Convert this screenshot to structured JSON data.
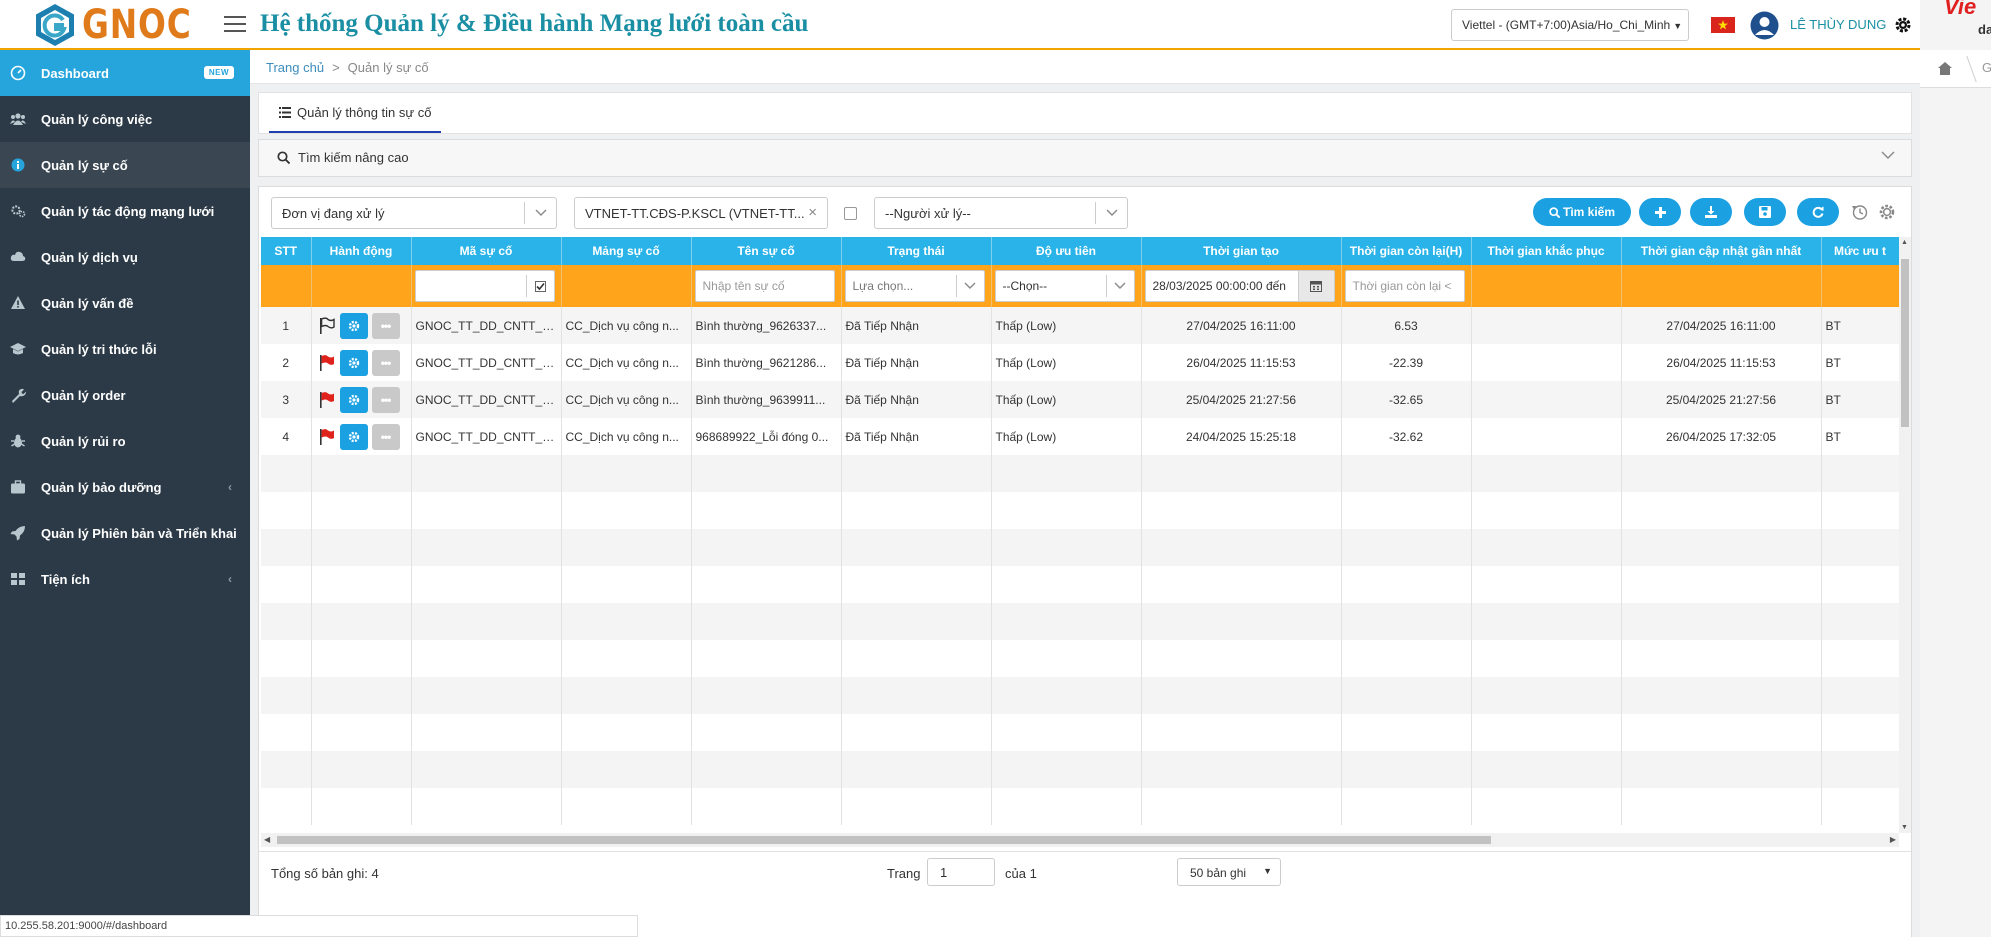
{
  "header": {
    "logo_text": "GNOC",
    "title": "Hệ thống Quản lý & Điều hành Mạng lưới toàn cầu",
    "timezone": "Viettel - (GMT+7:00)Asia/Ho_Chi_Minh",
    "user_name": "LÊ THÙY DUNG"
  },
  "right_strip": {
    "brand": "Vie",
    "brand_sub": "da",
    "crumb": "G"
  },
  "sidebar": {
    "items": [
      {
        "label": "Dashboard",
        "badge": "NEW",
        "icon": "dashboard-icon"
      },
      {
        "label": "Quản lý công việc",
        "icon": "users-icon"
      },
      {
        "label": "Quản lý sự cố",
        "icon": "info-icon"
      },
      {
        "label": "Quản lý tác động mạng lưới",
        "icon": "gears-icon"
      },
      {
        "label": "Quản lý dịch vụ",
        "icon": "cloud-icon"
      },
      {
        "label": "Quản lý vấn đề",
        "icon": "warning-icon"
      },
      {
        "label": "Quản lý tri thức lỗi",
        "icon": "graduation-cap-icon"
      },
      {
        "label": "Quản lý order",
        "icon": "wrench-icon"
      },
      {
        "label": "Quản lý rủi ro",
        "icon": "bug-icon"
      },
      {
        "label": "Quản lý bảo dưỡng",
        "icon": "briefcase-icon",
        "arrow": "‹"
      },
      {
        "label": "Quản lý Phiên bản và Triển khai",
        "icon": "rocket-icon"
      },
      {
        "label": "Tiện ích",
        "icon": "grid-icon",
        "arrow": "‹"
      }
    ]
  },
  "breadcrumb": {
    "home": "Trang chủ",
    "separator": ">",
    "current": "Quản lý sự cố"
  },
  "tab": {
    "label": "Quản lý thông tin sự cố"
  },
  "advanced_search": {
    "label": "Tìm kiếm nâng cao"
  },
  "filters": {
    "unit": "Đơn vị đang xử lý",
    "unit_selected": "VTNET-TT.CĐS-P.KSCL (VTNET-TT...",
    "clear_symbol": "×",
    "handler": "--Người xử lý--"
  },
  "toolbar": {
    "search_label": "Tìm kiếm"
  },
  "grid": {
    "columns": [
      "STT",
      "Hành động",
      "Mã sự cố",
      "Mảng sự cố",
      "Tên sự cố",
      "Trạng thái",
      "Độ ưu tiên",
      "Thời gian tạo",
      "Thời gian còn lại(H)",
      "Thời gian khắc phục",
      "Thời gian cập nhật gần nhất",
      "Mức ưu t"
    ],
    "filter_placeholders": {
      "name": "Nhập tên sự cố",
      "status": "Lựa chọn...",
      "priority": "--Chọn--",
      "created": "28/03/2025 00:00:00 đến",
      "remaining": "Thời gian còn lại <"
    },
    "rows": [
      {
        "stt": "1",
        "flag": "outline",
        "code": "GNOC_TT_DD_CNTT_2...",
        "area": "CC_Dịch vụ công n...",
        "name": "Bình thường_9626337...",
        "status": "Đã Tiếp Nhận",
        "priority": "Thấp (Low)",
        "created": "27/04/2025 16:11:00",
        "remaining": "6.53",
        "fix_time": "",
        "updated": "27/04/2025 16:11:00",
        "level": "BT"
      },
      {
        "stt": "2",
        "flag": "red",
        "code": "GNOC_TT_DD_CNTT_2...",
        "area": "CC_Dịch vụ công n...",
        "name": "Bình thường_9621286...",
        "status": "Đã Tiếp Nhận",
        "priority": "Thấp (Low)",
        "created": "26/04/2025 11:15:53",
        "remaining": "-22.39",
        "fix_time": "",
        "updated": "26/04/2025 11:15:53",
        "level": "BT"
      },
      {
        "stt": "3",
        "flag": "red",
        "code": "GNOC_TT_DD_CNTT_2...",
        "area": "CC_Dịch vụ công n...",
        "name": "Bình thường_9639911...",
        "status": "Đã Tiếp Nhận",
        "priority": "Thấp (Low)",
        "created": "25/04/2025 21:27:56",
        "remaining": "-32.65",
        "fix_time": "",
        "updated": "25/04/2025 21:27:56",
        "level": "BT"
      },
      {
        "stt": "4",
        "flag": "red",
        "code": "GNOC_TT_DD_CNTT_2...",
        "area": "CC_Dịch vụ công n...",
        "name": "968689922_Lỗi đóng 0...",
        "status": "Đã Tiếp Nhận",
        "priority": "Thấp (Low)",
        "created": "24/04/2025 15:25:18",
        "remaining": "-32.62",
        "fix_time": "",
        "updated": "26/04/2025 17:32:05",
        "level": "BT"
      }
    ],
    "more_label": "•••"
  },
  "footer": {
    "total_label": "Tổng số bản ghi: 4",
    "page_label": "Trang",
    "page_value": "1",
    "of_label": "của 1",
    "page_size": "50 bản ghi"
  },
  "status_url": "10.255.58.201:9000/#/dashboard",
  "colors": {
    "accent": "#25a5dc",
    "header_row": "#29b3e8",
    "filter_row": "#ffa41b",
    "title": "#1a8fa3",
    "sidebar": "#2c3a47",
    "flag_red": "#e0221c"
  }
}
